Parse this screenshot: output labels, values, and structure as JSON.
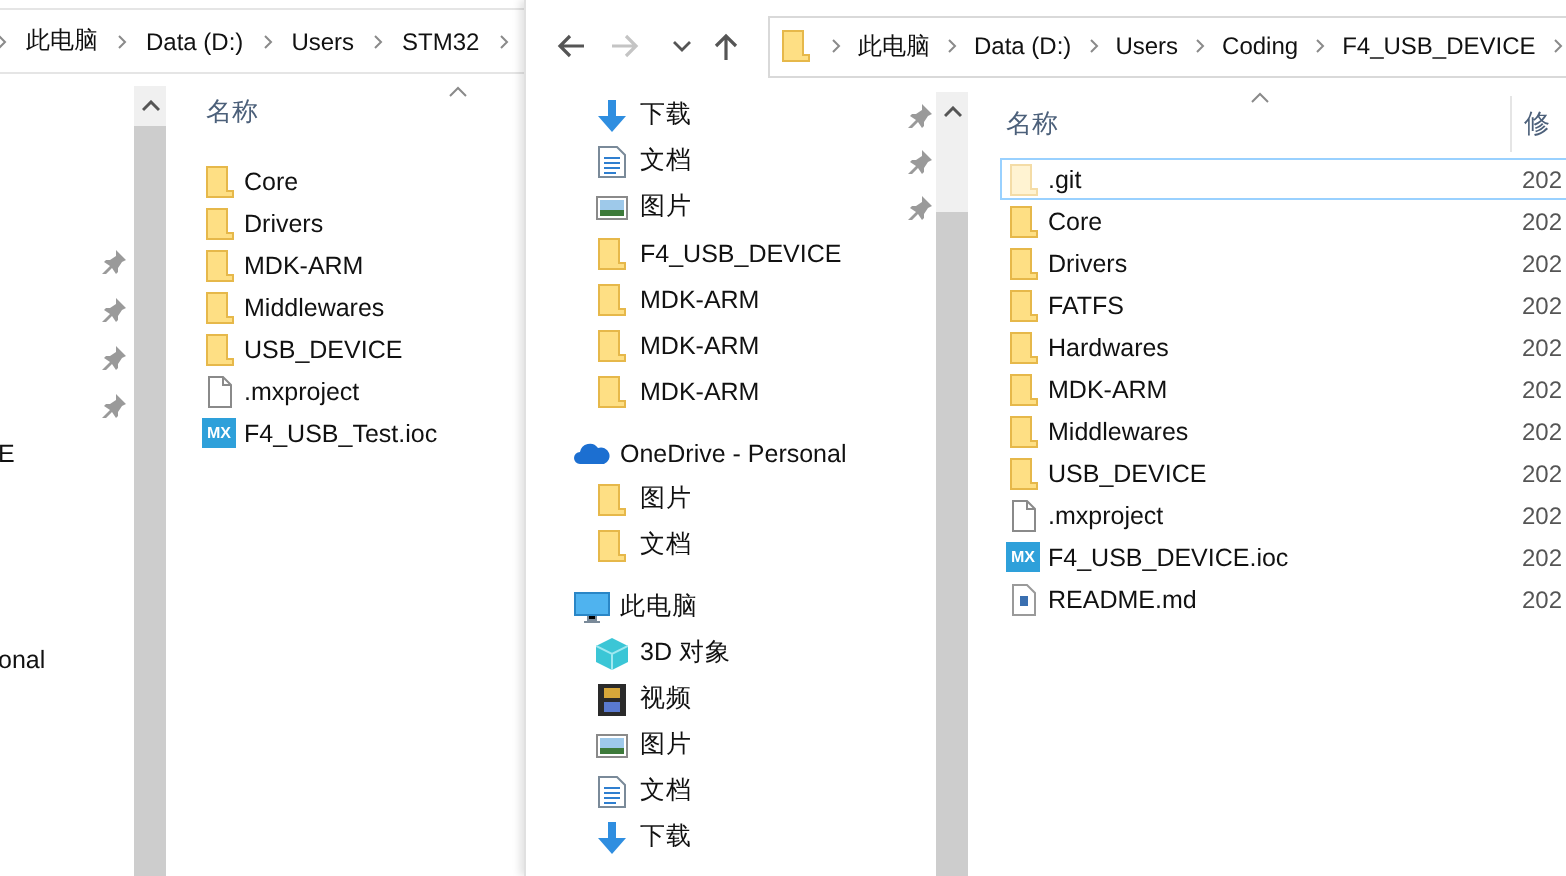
{
  "back_window": {
    "breadcrumb": [
      "此电脑",
      "Data (D:)",
      "Users",
      "STM32"
    ],
    "nav_groups": [
      {
        "items": [
          {
            "pinned": true
          },
          {
            "pinned": true
          },
          {
            "pinned": true
          },
          {
            "pinned": true
          },
          {
            "label": "E",
            "pinned": false
          }
        ]
      },
      {
        "items": [
          {
            "label": "onal",
            "pinned": false
          }
        ]
      }
    ],
    "columns": [
      "名称"
    ],
    "files": [
      {
        "name": "Core",
        "kind": "folder"
      },
      {
        "name": "Drivers",
        "kind": "folder"
      },
      {
        "name": "MDK-ARM",
        "kind": "folder"
      },
      {
        "name": "Middlewares",
        "kind": "folder"
      },
      {
        "name": "USB_DEVICE",
        "kind": "folder"
      },
      {
        "name": ".mxproject",
        "kind": "file"
      },
      {
        "name": "F4_USB_Test.ioc",
        "kind": "ioc",
        "badge": "MX"
      }
    ]
  },
  "front_window": {
    "nav_buttons": [
      {
        "kind": "back",
        "disabled": false
      },
      {
        "kind": "forward",
        "disabled": true
      },
      {
        "kind": "recent",
        "disabled": false
      },
      {
        "kind": "up",
        "disabled": false
      }
    ],
    "breadcrumb": [
      "此电脑",
      "Data (D:)",
      "Users",
      "Coding",
      "F4_USB_DEVICE"
    ],
    "nav_groups": [
      {
        "children": [
          {
            "label": "下载",
            "kind": "download",
            "pinned": true
          },
          {
            "label": "文档",
            "kind": "document",
            "pinned": true
          },
          {
            "label": "图片",
            "kind": "picture",
            "pinned": true
          },
          {
            "label": "F4_USB_DEVICE",
            "kind": "folder",
            "pinned": false
          },
          {
            "label": "MDK-ARM",
            "kind": "folder",
            "pinned": false
          },
          {
            "label": "MDK-ARM",
            "kind": "folder",
            "pinned": false
          },
          {
            "label": "MDK-ARM",
            "kind": "folder",
            "pinned": false
          }
        ]
      },
      {
        "label": "OneDrive - Personal",
        "kind": "cloud",
        "children": [
          {
            "label": "图片",
            "kind": "folder",
            "pinned": false
          },
          {
            "label": "文档",
            "kind": "folder",
            "pinned": false
          }
        ]
      },
      {
        "label": "此电脑",
        "kind": "pc",
        "children": [
          {
            "label": "3D 对象",
            "kind": "cube",
            "pinned": false
          },
          {
            "label": "视频",
            "kind": "video",
            "pinned": false
          },
          {
            "label": "图片",
            "kind": "picture",
            "pinned": false
          },
          {
            "label": "文档",
            "kind": "document",
            "pinned": false
          },
          {
            "label": "下载",
            "kind": "download",
            "pinned": false
          }
        ]
      }
    ],
    "columns": [
      "名称",
      "修"
    ],
    "files": [
      {
        "name": ".git",
        "kind": "hidden-folder",
        "date": "202",
        "selected": true
      },
      {
        "name": "Core",
        "kind": "folder",
        "date": "202",
        "selected": false
      },
      {
        "name": "Drivers",
        "kind": "folder",
        "date": "202",
        "selected": false
      },
      {
        "name": "FATFS",
        "kind": "folder",
        "date": "202",
        "selected": false
      },
      {
        "name": "Hardwares",
        "kind": "folder",
        "date": "202",
        "selected": false
      },
      {
        "name": "MDK-ARM",
        "kind": "folder",
        "date": "202",
        "selected": false
      },
      {
        "name": "Middlewares",
        "kind": "folder",
        "date": "202",
        "selected": false
      },
      {
        "name": "USB_DEVICE",
        "kind": "folder",
        "date": "202",
        "selected": false
      },
      {
        "name": ".mxproject",
        "kind": "file",
        "date": "202",
        "selected": false
      },
      {
        "name": "F4_USB_DEVICE.ioc",
        "kind": "ioc",
        "badge": "MX",
        "date": "202",
        "selected": false
      },
      {
        "name": "README.md",
        "kind": "markdown",
        "date": "202",
        "selected": false
      }
    ]
  }
}
